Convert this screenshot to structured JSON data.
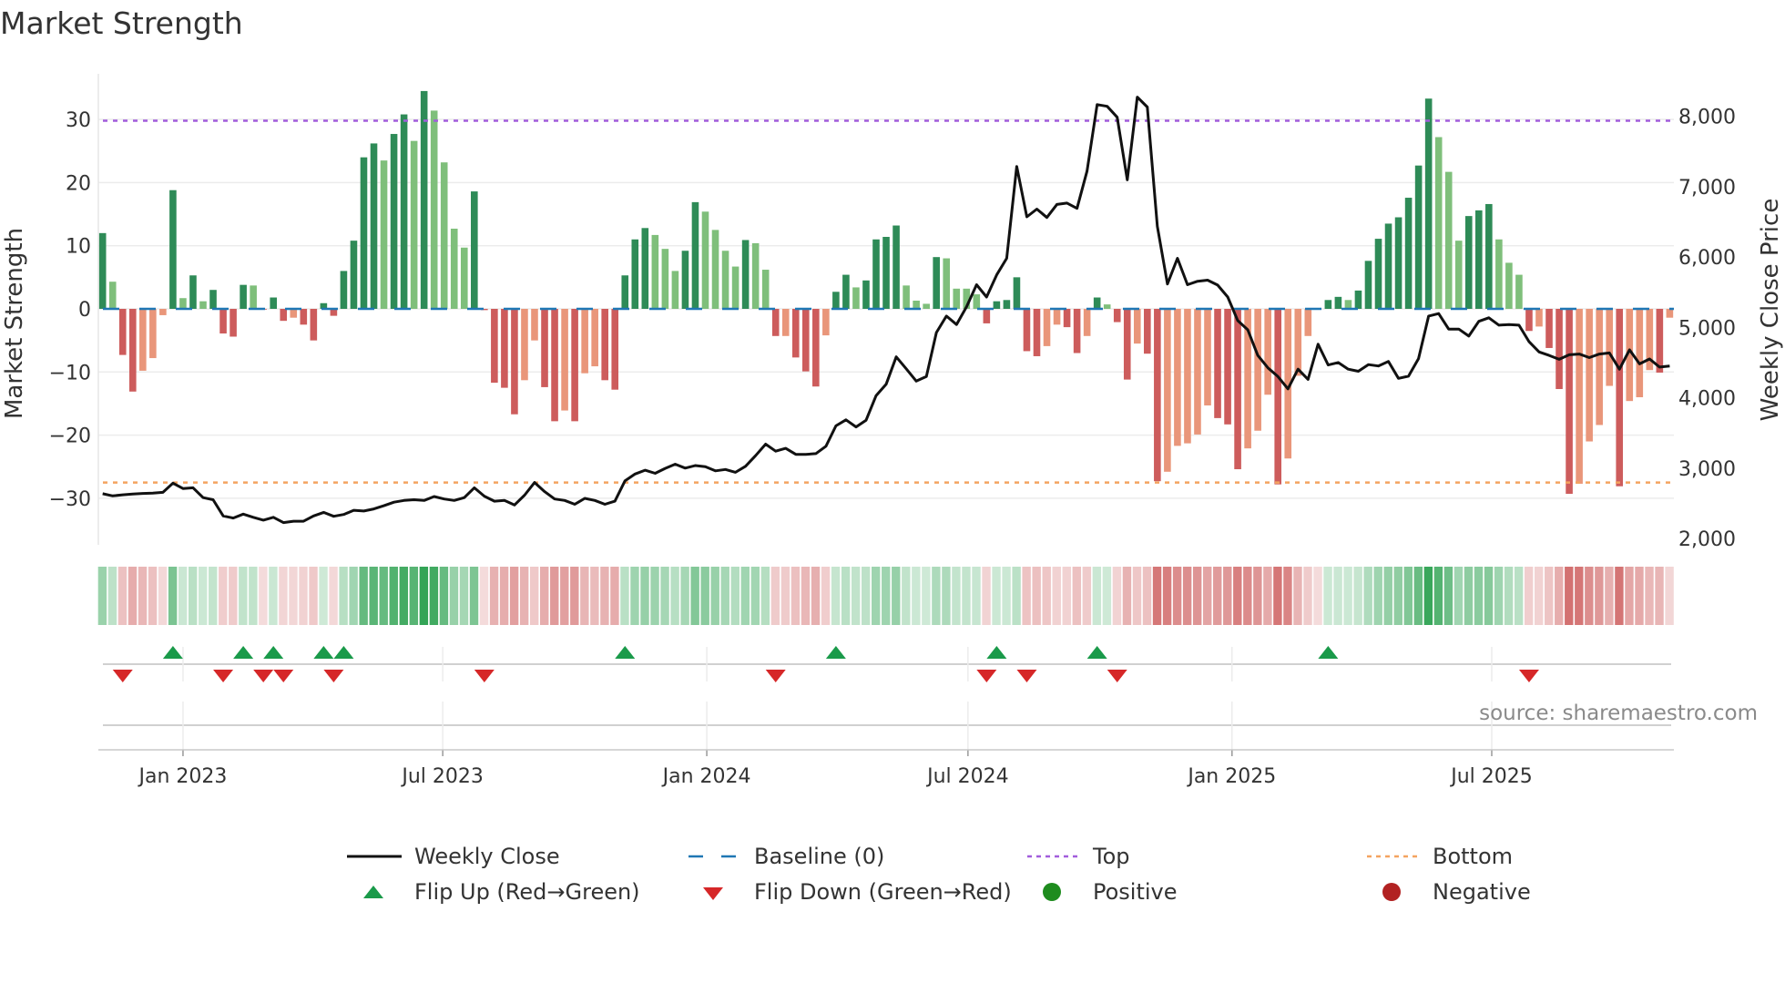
{
  "title": "Market Strength",
  "source": "source: sharemaestro.com",
  "colors": {
    "pos_strong": "#2e8b57",
    "pos_weak": "#7fbf7b",
    "neg_strong": "#cd5c5c",
    "neg_weak": "#e9967a",
    "baseline": "#1f77b4",
    "top": "#a25ddc",
    "bottom": "#f4a460",
    "close": "#111111",
    "flip_up": "#1a9a4a",
    "flip_down": "#d62728",
    "positive": "#1e8c1e",
    "negative": "#b22222",
    "strip_pos": "49,163,84",
    "strip_neg": "205,92,92"
  },
  "legend": [
    {
      "key": "close",
      "label": "Weekly Close"
    },
    {
      "key": "baseline",
      "label": "Baseline (0)"
    },
    {
      "key": "top",
      "label": "Top"
    },
    {
      "key": "bottom",
      "label": "Bottom"
    },
    {
      "key": "flip_up",
      "label": "Flip Up (Red→Green)"
    },
    {
      "key": "flip_down",
      "label": "Flip Down (Green→Red)"
    },
    {
      "key": "positive",
      "label": "Positive"
    },
    {
      "key": "negative",
      "label": "Negative"
    }
  ],
  "chart_data": {
    "type": "bar",
    "title": "Market Strength",
    "ylabel": "Market Strength",
    "y2label": "Weekly Close Price",
    "ylim": [
      -37.5,
      37.5
    ],
    "y2lim": [
      2000,
      8700
    ],
    "yticks": [
      30,
      20,
      10,
      0,
      -10,
      -20,
      -30
    ],
    "ytick_labels": [
      "30",
      "20",
      "10",
      "0",
      "−10",
      "−20",
      "−30"
    ],
    "y2ticks": [
      2000,
      3000,
      4000,
      5000,
      6000,
      7000,
      8000
    ],
    "y2tick_labels": [
      "2,000",
      "3,000",
      "4,000",
      "5,000",
      "6,000",
      "7,000",
      "8,000"
    ],
    "x_start_week": "2022-11-06",
    "x_step_days": 7,
    "xticks": [
      {
        "date": "2023-01-01",
        "label": "Jan 2023"
      },
      {
        "date": "2023-07-01",
        "label": "Jul 2023"
      },
      {
        "date": "2024-01-01",
        "label": "Jan 2024"
      },
      {
        "date": "2024-07-01",
        "label": "Jul 2024"
      },
      {
        "date": "2025-01-01",
        "label": "Jan 2025"
      },
      {
        "date": "2025-07-01",
        "label": "Jul 2025"
      }
    ],
    "top_level": 29.8,
    "bottom_level": -27.5,
    "baseline": 0,
    "strength": [
      12.0,
      4.3,
      -7.3,
      -13.1,
      -9.8,
      -7.8,
      -1.0,
      18.8,
      1.7,
      5.3,
      1.2,
      3.0,
      -3.9,
      -4.4,
      3.8,
      3.7,
      -0.1,
      1.8,
      -1.9,
      -1.4,
      -2.5,
      -5.0,
      0.9,
      -1.1,
      6.0,
      10.8,
      24.0,
      26.2,
      23.5,
      27.7,
      30.8,
      26.6,
      34.5,
      31.4,
      23.2,
      12.7,
      9.7,
      18.6,
      -0.2,
      -11.7,
      -12.5,
      -16.7,
      -11.3,
      -5.0,
      -12.4,
      -17.8,
      -16.1,
      -17.8,
      -10.2,
      -9.1,
      -11.3,
      -12.8,
      5.3,
      11.0,
      12.8,
      11.7,
      9.5,
      6.0,
      9.2,
      16.9,
      15.4,
      12.5,
      9.2,
      6.7,
      10.9,
      10.4,
      6.2,
      -4.3,
      -4.3,
      -7.7,
      -9.9,
      -12.3,
      -4.2,
      2.7,
      5.4,
      3.4,
      4.5,
      11.0,
      11.4,
      13.2,
      3.7,
      1.3,
      0.8,
      8.2,
      8.0,
      3.2,
      3.2,
      2.3,
      -2.3,
      1.2,
      1.4,
      5.0,
      -6.7,
      -7.5,
      -5.9,
      -2.5,
      -2.9,
      -7.0,
      -4.3,
      1.8,
      0.7,
      -2.1,
      -11.2,
      -5.5,
      -7.1,
      -27.3,
      -25.8,
      -21.7,
      -21.3,
      -19.9,
      -15.3,
      -17.3,
      -18.3,
      -25.4,
      -22.1,
      -19.3,
      -13.6,
      -27.8,
      -23.7,
      -10.6,
      -4.3,
      -0.1,
      1.4,
      1.9,
      1.4,
      2.9,
      7.6,
      11.1,
      13.5,
      14.5,
      17.6,
      22.7,
      33.3,
      27.2,
      21.7,
      10.8,
      14.7,
      15.6,
      16.6,
      11.0,
      7.3,
      5.4,
      -3.5,
      -2.8,
      -6.2,
      -12.7,
      -29.3,
      -27.7,
      -21.0,
      -18.4,
      -12.2,
      -28.1,
      -14.6,
      -14.0,
      -9.7,
      -10.1,
      -1.4
    ],
    "close": [
      2635,
      2605,
      2620,
      2630,
      2640,
      2645,
      2655,
      2786,
      2710,
      2720,
      2580,
      2550,
      2320,
      2290,
      2345,
      2300,
      2260,
      2300,
      2225,
      2245,
      2245,
      2320,
      2370,
      2315,
      2340,
      2400,
      2390,
      2420,
      2465,
      2515,
      2540,
      2550,
      2540,
      2595,
      2560,
      2540,
      2580,
      2720,
      2600,
      2530,
      2540,
      2475,
      2615,
      2795,
      2665,
      2560,
      2540,
      2485,
      2570,
      2540,
      2485,
      2530,
      2820,
      2915,
      2970,
      2925,
      2995,
      3055,
      3000,
      3035,
      3020,
      2960,
      2980,
      2940,
      3025,
      3175,
      3340,
      3240,
      3280,
      3195,
      3195,
      3205,
      3310,
      3600,
      3685,
      3585,
      3680,
      4030,
      4190,
      4580,
      4410,
      4235,
      4300,
      4925,
      5160,
      5040,
      5290,
      5605,
      5430,
      5745,
      5980,
      7285,
      6570,
      6680,
      6560,
      6745,
      6765,
      6690,
      7220,
      8165,
      8140,
      7985,
      7095,
      8270,
      8130,
      6435,
      5615,
      5980,
      5605,
      5655,
      5670,
      5600,
      5430,
      5095,
      4965,
      4600,
      4425,
      4300,
      4125,
      4405,
      4260,
      4760,
      4465,
      4500,
      4405,
      4375,
      4470,
      4450,
      4515,
      4275,
      4305,
      4555,
      5160,
      5195,
      4975,
      4975,
      4875,
      5085,
      5135,
      5030,
      5040,
      5030,
      4795,
      4650,
      4600,
      4545,
      4610,
      4620,
      4570,
      4620,
      4635,
      4405,
      4680,
      4480,
      4550,
      4435,
      4450
    ],
    "flip_up_weeks": [
      7,
      14,
      17,
      22,
      24,
      52,
      73,
      89,
      99,
      122
    ],
    "flip_down_weeks": [
      2,
      12,
      16,
      18,
      23,
      38,
      67,
      88,
      92,
      101,
      142
    ]
  }
}
